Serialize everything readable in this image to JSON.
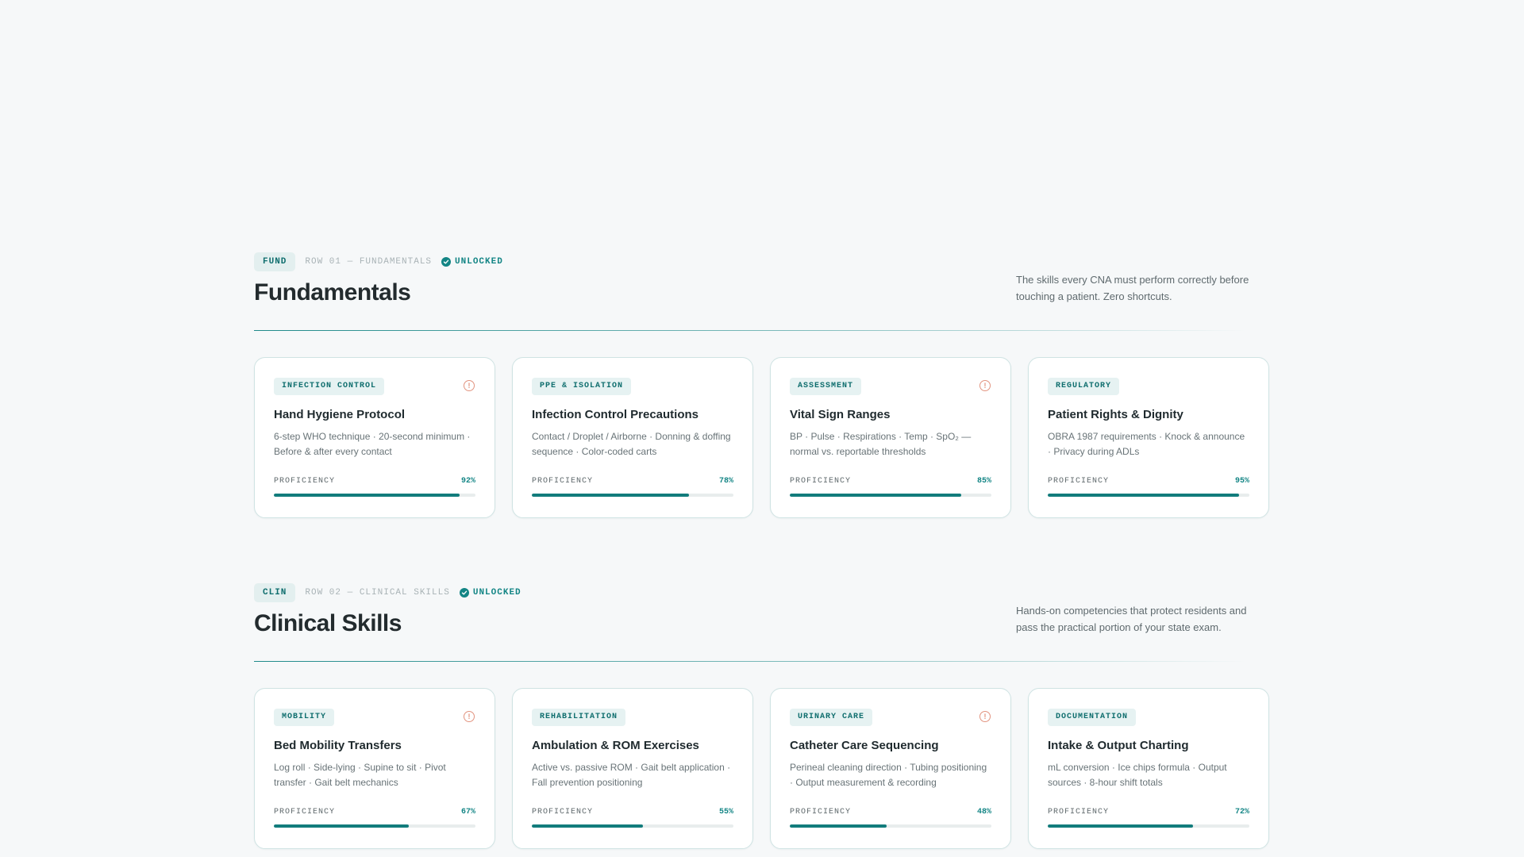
{
  "sections": [
    {
      "code": "FUND",
      "row_label": "ROW 01 — FUNDAMENTALS",
      "status": "UNLOCKED",
      "title": "Fundamentals",
      "description": "The skills every CNA must perform correctly before touching a patient. Zero shortcuts.",
      "cards": [
        {
          "tag": "INFECTION CONTROL",
          "title": "Hand Hygiene Protocol",
          "description": "6-step WHO technique · 20-second minimum · Before & after every contact",
          "proficiency_label": "PROFICIENCY",
          "proficiency": "92%",
          "proficiency_value": 92,
          "alert": true,
          "alert_icon": "alert-circle-icon"
        },
        {
          "tag": "PPE & ISOLATION",
          "title": "Infection Control Precautions",
          "description": "Contact / Droplet / Airborne · Donning & doffing sequence · Color-coded carts",
          "proficiency_label": "PROFICIENCY",
          "proficiency": "78%",
          "proficiency_value": 78,
          "alert": false
        },
        {
          "tag": "ASSESSMENT",
          "title": "Vital Sign Ranges",
          "description": "BP · Pulse · Respirations · Temp · SpO₂ — normal vs. reportable thresholds",
          "proficiency_label": "PROFICIENCY",
          "proficiency": "85%",
          "proficiency_value": 85,
          "alert": true,
          "alert_icon": "alert-circle-icon"
        },
        {
          "tag": "REGULATORY",
          "title": "Patient Rights & Dignity",
          "description": "OBRA 1987 requirements · Knock & announce · Privacy during ADLs",
          "proficiency_label": "PROFICIENCY",
          "proficiency": "95%",
          "proficiency_value": 95,
          "alert": false
        }
      ]
    },
    {
      "code": "CLIN",
      "row_label": "ROW 02 — CLINICAL SKILLS",
      "status": "UNLOCKED",
      "title": "Clinical Skills",
      "description": "Hands-on competencies that protect residents and pass the practical portion of your state exam.",
      "cards": [
        {
          "tag": "MOBILITY",
          "title": "Bed Mobility Transfers",
          "description": "Log roll · Side-lying · Supine to sit · Pivot transfer · Gait belt mechanics",
          "proficiency_label": "PROFICIENCY",
          "proficiency": "67%",
          "proficiency_value": 67,
          "alert": true,
          "alert_icon": "alert-circle-icon"
        },
        {
          "tag": "REHABILITATION",
          "title": "Ambulation & ROM Exercises",
          "description": "Active vs. passive ROM · Gait belt application · Fall prevention positioning",
          "proficiency_label": "PROFICIENCY",
          "proficiency": "55%",
          "proficiency_value": 55,
          "alert": false
        },
        {
          "tag": "URINARY CARE",
          "title": "Catheter Care Sequencing",
          "description": "Perineal cleaning direction · Tubing positioning · Output measurement & recording",
          "proficiency_label": "PROFICIENCY",
          "proficiency": "48%",
          "proficiency_value": 48,
          "alert": true,
          "alert_icon": "alert-circle-icon"
        },
        {
          "tag": "DOCUMENTATION",
          "title": "Intake & Output Charting",
          "description": "mL conversion · Ice chips formula · Output sources · 8-hour shift totals",
          "proficiency_label": "PROFICIENCY",
          "proficiency": "72%",
          "proficiency_value": 72,
          "alert": false
        }
      ]
    }
  ],
  "colors": {
    "accent": "#138585",
    "bar_fill": "#127c7c",
    "alert": "#e2937f",
    "background": "#f6f8f9"
  }
}
